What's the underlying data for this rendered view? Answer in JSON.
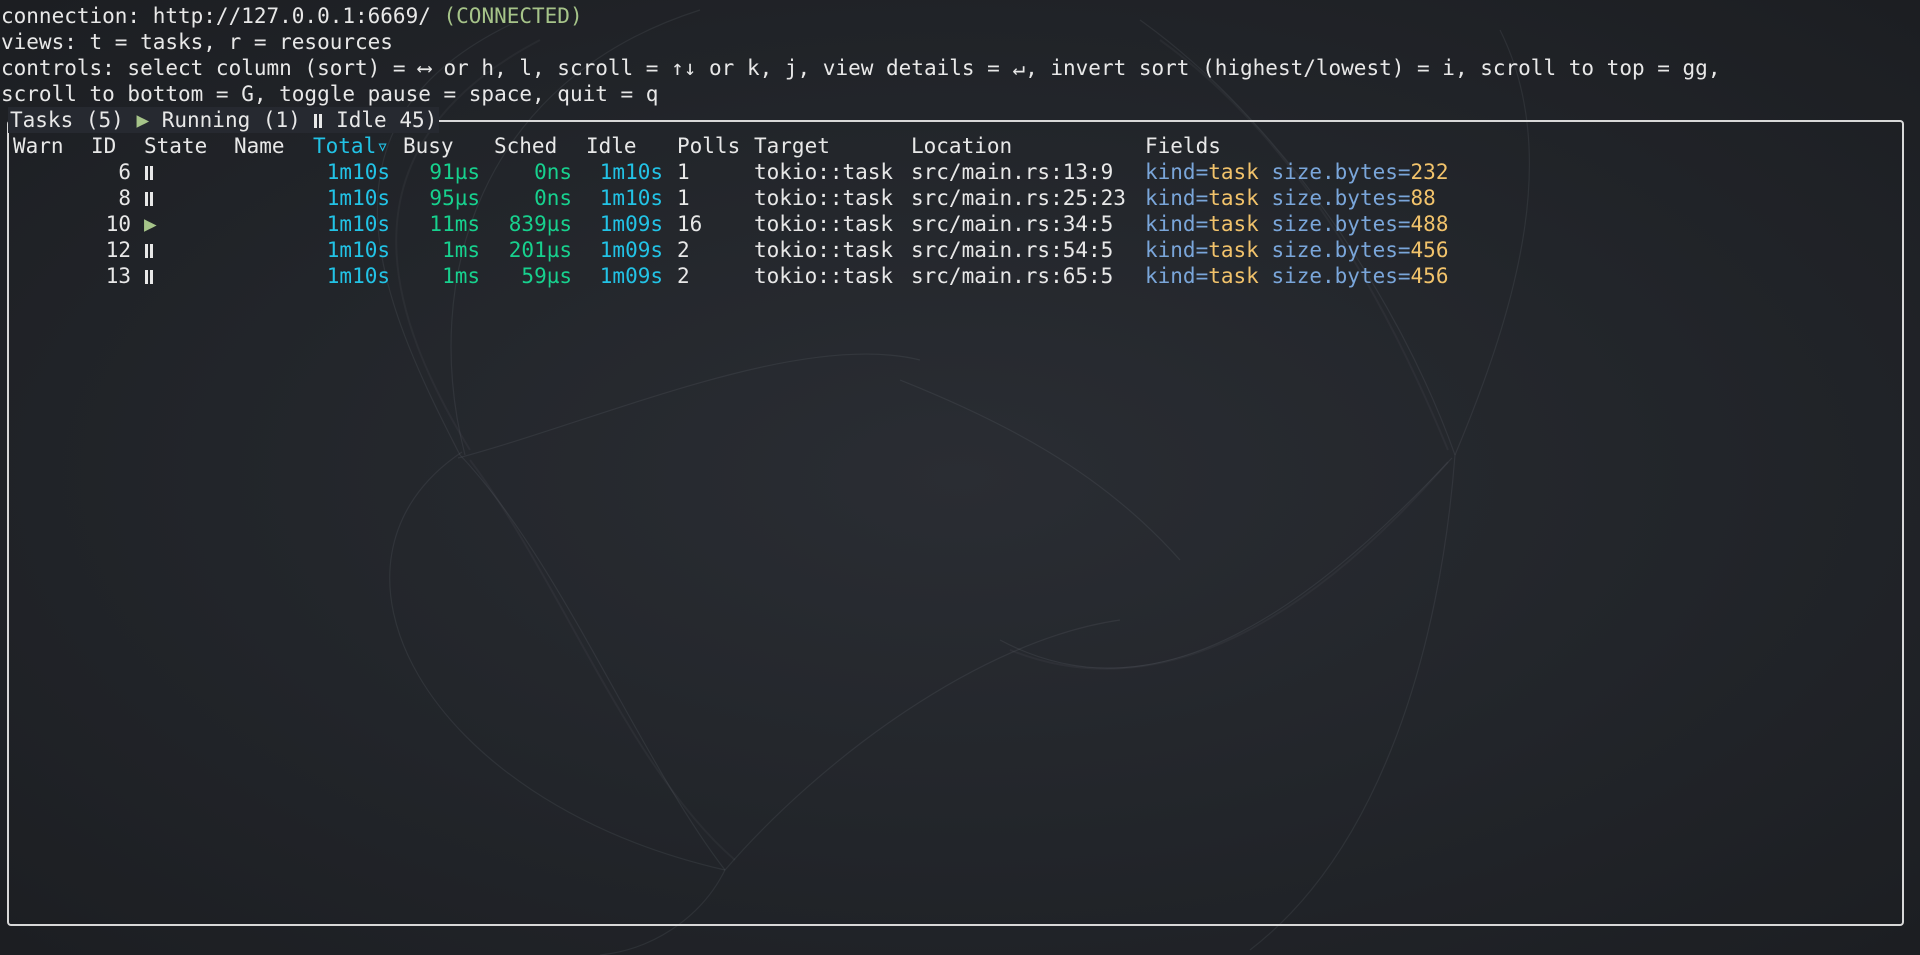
{
  "header": {
    "connection_label": "connection: http://127.0.0.1:6669/ ",
    "connection_status": "(CONNECTED)",
    "views": "views: t = tasks, r = resources",
    "controls_1": "controls: select column (sort) = ⟷ or h, l, scroll = ↑↓ or k, j, view details = ↵, invert sort (highest/lowest) = i, scroll to top = gg,",
    "controls_2": "scroll to bottom = G, toggle pause = space, quit = q"
  },
  "panel": {
    "tasks_label": "Tasks (5) ",
    "running_label": " Running (1) ",
    "idle_label": " Idle 45)"
  },
  "columns": {
    "warn": "Warn",
    "id": "ID",
    "state": "State",
    "name": "Name",
    "total": "Total▿",
    "busy": "Busy",
    "sched": "Sched",
    "idle": "Idle",
    "polls": "Polls",
    "target": "Target",
    "location": "Location",
    "fields": "Fields"
  },
  "tasks": [
    {
      "id": "6",
      "state": "paused",
      "total": "1m10s",
      "busy": "91µs",
      "sched": "0ns",
      "idle": "1m10s",
      "polls": "1",
      "target": "tokio::task",
      "location": "src/main.rs:13:9",
      "kind_key": "kind=",
      "kind_val": "task",
      "size_key": "size.bytes=",
      "size_val": "232"
    },
    {
      "id": "8",
      "state": "paused",
      "total": "1m10s",
      "busy": "95µs",
      "sched": "0ns",
      "idle": "1m10s",
      "polls": "1",
      "target": "tokio::task",
      "location": "src/main.rs:25:23",
      "kind_key": "kind=",
      "kind_val": "task",
      "size_key": "size.bytes=",
      "size_val": "88"
    },
    {
      "id": "10",
      "state": "running",
      "total": "1m10s",
      "busy": "11ms",
      "sched": "839µs",
      "idle": "1m09s",
      "polls": "16",
      "target": "tokio::task",
      "location": "src/main.rs:34:5",
      "kind_key": "kind=",
      "kind_val": "task",
      "size_key": "size.bytes=",
      "size_val": "488"
    },
    {
      "id": "12",
      "state": "paused",
      "total": "1m10s",
      "busy": "1ms",
      "sched": "201µs",
      "idle": "1m09s",
      "polls": "2",
      "target": "tokio::task",
      "location": "src/main.rs:54:5",
      "kind_key": "kind=",
      "kind_val": "task",
      "size_key": "size.bytes=",
      "size_val": "456"
    },
    {
      "id": "13",
      "state": "paused",
      "total": "1m10s",
      "busy": "1ms",
      "sched": "59µs",
      "idle": "1m09s",
      "polls": "2",
      "target": "tokio::task",
      "location": "src/main.rs:65:5",
      "kind_key": "kind=",
      "kind_val": "task",
      "size_key": "size.bytes=",
      "size_val": "456"
    }
  ],
  "colors": {
    "connected": "#a6c489",
    "time_primary": "#22c3e6",
    "time_secondary": "#17d18e",
    "field_key": "#7aa6da",
    "field_value": "#f2c36b",
    "running_icon": "#a6c489"
  }
}
